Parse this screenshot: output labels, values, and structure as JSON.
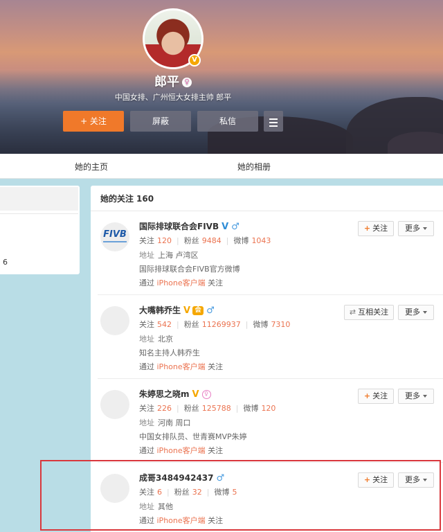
{
  "profile": {
    "name": "郎平",
    "description": "中国女排、广州恒大女排主帅 郎平",
    "verified_badge": "V",
    "buttons": {
      "follow": "+ 关注",
      "block": "屏蔽",
      "message": "私信"
    }
  },
  "tabs": [
    "她的主页",
    "她的相册"
  ],
  "left_card": {
    "number": "6"
  },
  "following": {
    "title": "她的关注",
    "count": "160",
    "labels": {
      "follow_count": "关注",
      "fans": "粉丝",
      "weibo": "微博",
      "address": "地址",
      "via_prefix": "通过",
      "via_suffix": "关注"
    },
    "entries": [
      {
        "name": "国际排球联合会FIVB",
        "avatar_text": "FIVB",
        "verify": "V",
        "verify_color": "#2f8dd6",
        "gender_icon": "♂",
        "follow": "120",
        "fans": "9484",
        "weibo": "1043",
        "address": "上海 卢湾区",
        "intro": "国际排球联合会FIVB官方微博",
        "via": "iPhone客户端",
        "action": "关注",
        "more": "更多"
      },
      {
        "name": "大嘴韩乔生",
        "verify": "V",
        "verify_color": "#f5a700",
        "gender_icon": "♂",
        "follow": "542",
        "fans": "11269937",
        "weibo": "7310",
        "address": "北京",
        "intro": "知名主持人韩乔生",
        "via": "iPhone客户端",
        "action": "互相关注",
        "more": "更多"
      },
      {
        "name": "朱婷思之晓m",
        "verify": "V",
        "verify_color": "#f5a700",
        "gender_icon": "♀",
        "follow": "226",
        "fans": "125788",
        "weibo": "120",
        "address": "河南 周口",
        "intro": "中国女排队员、世青赛MVP朱婷",
        "via": "iPhone客户端",
        "action": "关注",
        "more": "更多"
      },
      {
        "name": "成哥3484942437",
        "gender_icon": "♂",
        "follow": "6",
        "fans": "32",
        "weibo": "5",
        "address": "其他",
        "via": "iPhone客户端",
        "action": "关注",
        "more": "更多"
      }
    ]
  },
  "colors": {
    "accent_orange": "#f0792a",
    "highlight_red": "#d9373c",
    "link_orange": "#eb7350",
    "page_bg": "#b9dde6"
  }
}
